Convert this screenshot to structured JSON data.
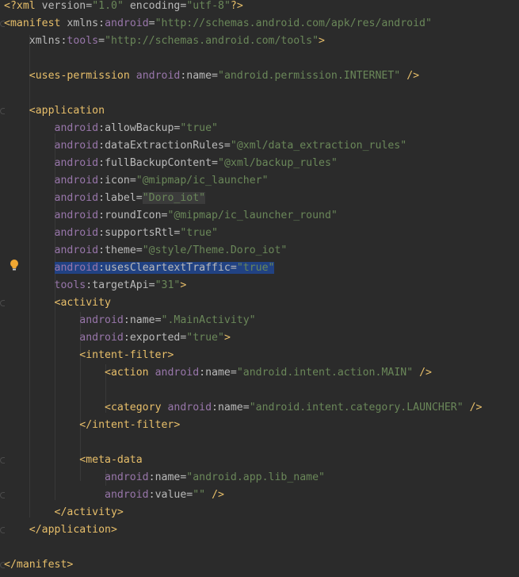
{
  "editor": {
    "language": "xml",
    "file_kind": "AndroidManifest",
    "colors": {
      "background": "#2b2b2b",
      "tag": "#e8bf6a",
      "namespace": "#9876aa",
      "attribute": "#bababa",
      "value": "#6a8759",
      "selection": "#214283",
      "bulb": "#f0a732"
    },
    "icons": [
      "intention-bulb-icon",
      "fold-marker-icon"
    ],
    "lines": [
      [
        [
          "decl",
          "<?"
        ],
        [
          "tag",
          "xml "
        ],
        [
          "attr",
          "version"
        ],
        [
          "punct",
          "="
        ],
        [
          "val",
          "\"1.0\""
        ],
        [
          "attr",
          " encoding"
        ],
        [
          "punct",
          "="
        ],
        [
          "val",
          "\"utf-8\""
        ],
        [
          "decl",
          "?>"
        ]
      ],
      [
        [
          "tag",
          "<manifest "
        ],
        [
          "attr",
          "xmlns"
        ],
        [
          "punct",
          ":"
        ],
        [
          "ns",
          "android"
        ],
        [
          "punct",
          "="
        ],
        [
          "val",
          "\"http://schemas.android.com/apk/res/android\""
        ]
      ],
      [
        [
          "plain",
          "    "
        ],
        [
          "attr",
          "xmlns"
        ],
        [
          "punct",
          ":"
        ],
        [
          "ns",
          "tools"
        ],
        [
          "punct",
          "="
        ],
        [
          "val",
          "\"http://schemas.android.com/tools\""
        ],
        [
          "tag",
          ">"
        ]
      ],
      [],
      [
        [
          "plain",
          "    "
        ],
        [
          "tag",
          "<uses-permission "
        ],
        [
          "ns",
          "android"
        ],
        [
          "punct",
          ":"
        ],
        [
          "attr",
          "name"
        ],
        [
          "punct",
          "="
        ],
        [
          "val",
          "\"android.permission.INTERNET\""
        ],
        [
          "tag",
          " />"
        ]
      ],
      [],
      [
        [
          "plain",
          "    "
        ],
        [
          "tag",
          "<application"
        ]
      ],
      [
        [
          "plain",
          "        "
        ],
        [
          "ns",
          "android"
        ],
        [
          "punct",
          ":"
        ],
        [
          "attr",
          "allowBackup"
        ],
        [
          "punct",
          "="
        ],
        [
          "val",
          "\"true\""
        ]
      ],
      [
        [
          "plain",
          "        "
        ],
        [
          "ns",
          "android"
        ],
        [
          "punct",
          ":"
        ],
        [
          "attr",
          "dataExtractionRules"
        ],
        [
          "punct",
          "="
        ],
        [
          "val",
          "\"@xml/data_extraction_rules\""
        ]
      ],
      [
        [
          "plain",
          "        "
        ],
        [
          "ns",
          "android"
        ],
        [
          "punct",
          ":"
        ],
        [
          "attr",
          "fullBackupContent"
        ],
        [
          "punct",
          "="
        ],
        [
          "val",
          "\"@xml/backup_rules\""
        ]
      ],
      [
        [
          "plain",
          "        "
        ],
        [
          "ns",
          "android"
        ],
        [
          "punct",
          ":"
        ],
        [
          "attr",
          "icon"
        ],
        [
          "punct",
          "="
        ],
        [
          "val",
          "\"@mipmap/ic_launcher\""
        ]
      ],
      [
        [
          "plain",
          "        "
        ],
        [
          "ns",
          "android"
        ],
        [
          "punct",
          ":"
        ],
        [
          "attr",
          "label"
        ],
        [
          "punct",
          "="
        ],
        [
          "valword",
          "\"Doro_iot\""
        ]
      ],
      [
        [
          "plain",
          "        "
        ],
        [
          "ns",
          "android"
        ],
        [
          "punct",
          ":"
        ],
        [
          "attr",
          "roundIcon"
        ],
        [
          "punct",
          "="
        ],
        [
          "val",
          "\"@mipmap/ic_launcher_round\""
        ]
      ],
      [
        [
          "plain",
          "        "
        ],
        [
          "ns",
          "android"
        ],
        [
          "punct",
          ":"
        ],
        [
          "attr",
          "supportsRtl"
        ],
        [
          "punct",
          "="
        ],
        [
          "val",
          "\"true\""
        ]
      ],
      [
        [
          "plain",
          "        "
        ],
        [
          "ns",
          "android"
        ],
        [
          "punct",
          ":"
        ],
        [
          "attr",
          "theme"
        ],
        [
          "punct",
          "="
        ],
        [
          "val",
          "\"@style/Theme.Doro_iot\""
        ]
      ],
      [
        [
          "plain",
          "        "
        ],
        [
          "nssel",
          "android"
        ],
        [
          "punctsel",
          ":"
        ],
        [
          "attrsel",
          "usesCleartextTraffic"
        ],
        [
          "punctsel",
          "="
        ],
        [
          "valsel",
          "\"true\""
        ]
      ],
      [
        [
          "plain",
          "        "
        ],
        [
          "ns",
          "tools"
        ],
        [
          "punct",
          ":"
        ],
        [
          "attr",
          "targetApi"
        ],
        [
          "punct",
          "="
        ],
        [
          "val",
          "\"31\""
        ],
        [
          "tag",
          ">"
        ]
      ],
      [
        [
          "plain",
          "        "
        ],
        [
          "tag",
          "<activity"
        ]
      ],
      [
        [
          "plain",
          "            "
        ],
        [
          "ns",
          "android"
        ],
        [
          "punct",
          ":"
        ],
        [
          "attr",
          "name"
        ],
        [
          "punct",
          "="
        ],
        [
          "val",
          "\".MainActivity\""
        ]
      ],
      [
        [
          "plain",
          "            "
        ],
        [
          "ns",
          "android"
        ],
        [
          "punct",
          ":"
        ],
        [
          "attr",
          "exported"
        ],
        [
          "punct",
          "="
        ],
        [
          "val",
          "\"true\""
        ],
        [
          "tag",
          ">"
        ]
      ],
      [
        [
          "plain",
          "            "
        ],
        [
          "tag",
          "<intent-filter>"
        ]
      ],
      [
        [
          "plain",
          "                "
        ],
        [
          "tag",
          "<action "
        ],
        [
          "ns",
          "android"
        ],
        [
          "punct",
          ":"
        ],
        [
          "attr",
          "name"
        ],
        [
          "punct",
          "="
        ],
        [
          "val",
          "\"android.intent.action.MAIN\""
        ],
        [
          "tag",
          " />"
        ]
      ],
      [],
      [
        [
          "plain",
          "                "
        ],
        [
          "tag",
          "<category "
        ],
        [
          "ns",
          "android"
        ],
        [
          "punct",
          ":"
        ],
        [
          "attr",
          "name"
        ],
        [
          "punct",
          "="
        ],
        [
          "val",
          "\"android.intent.category.LAUNCHER\""
        ],
        [
          "tag",
          " />"
        ]
      ],
      [
        [
          "plain",
          "            "
        ],
        [
          "tag",
          "</intent-filter>"
        ]
      ],
      [],
      [
        [
          "plain",
          "            "
        ],
        [
          "tag",
          "<meta-data"
        ]
      ],
      [
        [
          "plain",
          "                "
        ],
        [
          "ns",
          "android"
        ],
        [
          "punct",
          ":"
        ],
        [
          "attr",
          "name"
        ],
        [
          "punct",
          "="
        ],
        [
          "val",
          "\"android.app.lib_name\""
        ]
      ],
      [
        [
          "plain",
          "                "
        ],
        [
          "ns",
          "android"
        ],
        [
          "punct",
          ":"
        ],
        [
          "attr",
          "value"
        ],
        [
          "punct",
          "="
        ],
        [
          "val",
          "\"\""
        ],
        [
          "tag",
          " />"
        ]
      ],
      [
        [
          "plain",
          "        "
        ],
        [
          "tag",
          "</activity>"
        ]
      ],
      [
        [
          "plain",
          "    "
        ],
        [
          "tag",
          "</application>"
        ]
      ],
      [],
      [
        [
          "tag",
          "</manifest>"
        ]
      ]
    ]
  }
}
